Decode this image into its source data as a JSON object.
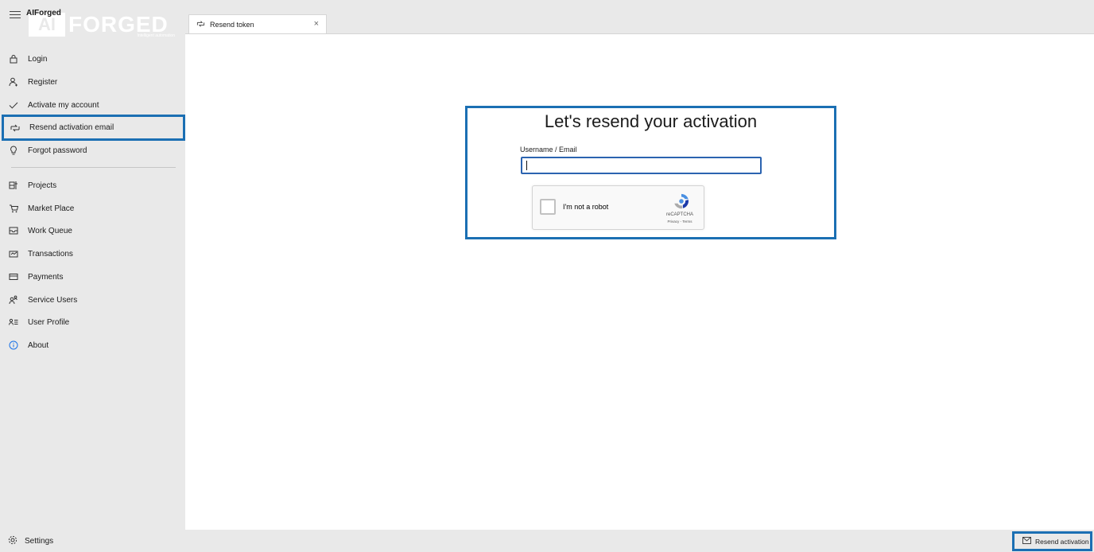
{
  "app": {
    "title": "AIForged",
    "logo_mark": "AI",
    "logo_word": "FORGED",
    "logo_tagline": "Intelligent automation"
  },
  "sidebar": {
    "items": [
      {
        "label": "Login",
        "icon": "lock-icon"
      },
      {
        "label": "Register",
        "icon": "person-add-icon"
      },
      {
        "label": "Activate my account",
        "icon": "checkmark-icon"
      },
      {
        "label": "Resend activation email",
        "icon": "resend-icon",
        "selected": true
      },
      {
        "label": "Forgot password",
        "icon": "lightbulb-icon"
      },
      {
        "label": "Projects",
        "icon": "projects-icon"
      },
      {
        "label": "Market Place",
        "icon": "cart-icon"
      },
      {
        "label": "Work Queue",
        "icon": "inbox-icon"
      },
      {
        "label": "Transactions",
        "icon": "transactions-icon"
      },
      {
        "label": "Payments",
        "icon": "card-icon"
      },
      {
        "label": "Service Users",
        "icon": "users-icon"
      },
      {
        "label": "User Profile",
        "icon": "profile-icon"
      },
      {
        "label": "About",
        "icon": "info-icon"
      }
    ],
    "settings_label": "Settings"
  },
  "tabs": [
    {
      "label": "Resend token",
      "close": "×"
    }
  ],
  "form": {
    "title": "Let's resend your activation",
    "field_label": "Username / Email",
    "field_value": "",
    "recaptcha_label": "I'm not a robot",
    "recaptcha_brand": "reCAPTCHA",
    "recaptcha_terms": "Privacy - Terms"
  },
  "status_bar": {
    "button_label": "Resend activation"
  },
  "colors": {
    "accent": "#1b6fb3",
    "sidebar_bg": "#e9e9e9",
    "content_bg": "#ffffff",
    "info": "#1a73e8"
  }
}
